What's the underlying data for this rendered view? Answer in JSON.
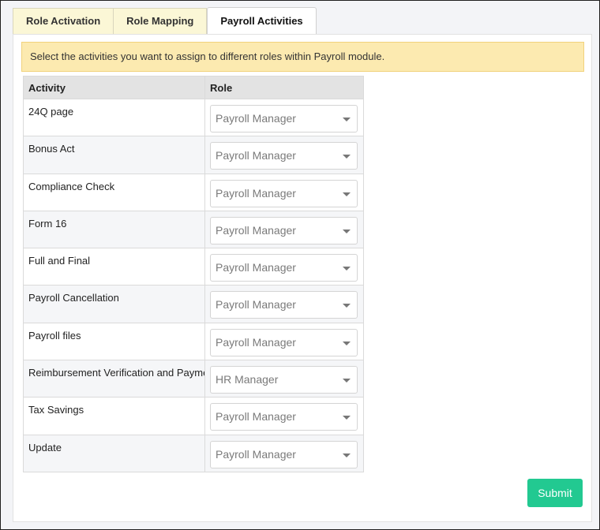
{
  "tabs": [
    {
      "label": "Role Activation",
      "active": false
    },
    {
      "label": "Role Mapping",
      "active": false
    },
    {
      "label": "Payroll Activities",
      "active": true
    }
  ],
  "alert": {
    "text": "Select the activities you want to assign to different roles within Payroll module."
  },
  "table": {
    "headers": {
      "activity": "Activity",
      "role": "Role"
    },
    "rows": [
      {
        "activity": "24Q page",
        "role": "Payroll Manager"
      },
      {
        "activity": "Bonus Act",
        "role": "Payroll Manager"
      },
      {
        "activity": "Compliance Check",
        "role": "Payroll Manager"
      },
      {
        "activity": "Form 16",
        "role": "Payroll Manager"
      },
      {
        "activity": "Full and Final",
        "role": "Payroll Manager"
      },
      {
        "activity": "Payroll Cancellation",
        "role": "Payroll Manager"
      },
      {
        "activity": "Payroll files",
        "role": "Payroll Manager"
      },
      {
        "activity": "Reimbursement Verification and Payment",
        "role": "HR Manager"
      },
      {
        "activity": "Tax Savings",
        "role": "Payroll Manager"
      },
      {
        "activity": "Update",
        "role": "Payroll Manager"
      }
    ]
  },
  "actions": {
    "submit_label": "Submit"
  },
  "colors": {
    "submit": "#22c991",
    "alert_bg": "#fceab0",
    "tab_bg": "#fbf7d6"
  }
}
